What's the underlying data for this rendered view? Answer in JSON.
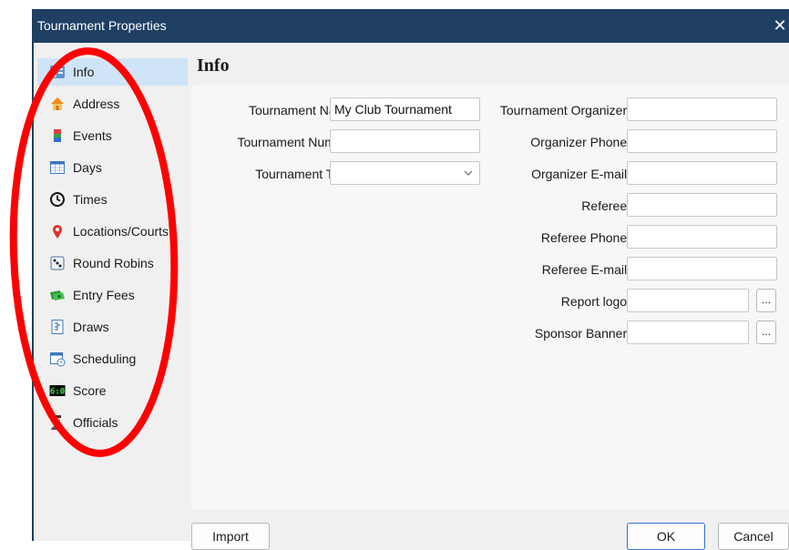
{
  "window": {
    "title": "Tournament Properties",
    "close_glyph": "✕"
  },
  "sidebar": {
    "items": [
      {
        "label": "Info",
        "icon": "info-icon"
      },
      {
        "label": "Address",
        "icon": "house-icon"
      },
      {
        "label": "Events",
        "icon": "events-icon"
      },
      {
        "label": "Days",
        "icon": "calendar-icon"
      },
      {
        "label": "Times",
        "icon": "clock-icon"
      },
      {
        "label": "Locations/Courts",
        "icon": "location-pin-icon"
      },
      {
        "label": "Round Robins",
        "icon": "round-robin-icon"
      },
      {
        "label": "Entry Fees",
        "icon": "money-icon"
      },
      {
        "label": "Draws",
        "icon": "draws-icon"
      },
      {
        "label": "Scheduling",
        "icon": "scheduling-icon"
      },
      {
        "label": "Score",
        "icon": "score-icon"
      },
      {
        "label": "Officials",
        "icon": "officials-icon"
      }
    ],
    "selected": "Info"
  },
  "main": {
    "title": "Info",
    "left_fields": {
      "tournament_name": {
        "label": "Tournament Name:",
        "value": "My Club Tournament"
      },
      "tournament_number": {
        "label": "Tournament Number:",
        "value": ""
      },
      "tournament_type": {
        "label": "Tournament Type:",
        "value": ""
      }
    },
    "right_fields": {
      "organizer": {
        "label": "Tournament Organizer:",
        "value": ""
      },
      "organizer_phone": {
        "label": "Organizer Phone:",
        "value": ""
      },
      "organizer_email": {
        "label": "Organizer E-mail:",
        "value": ""
      },
      "referee": {
        "label": "Referee:",
        "value": ""
      },
      "referee_phone": {
        "label": "Referee Phone:",
        "value": ""
      },
      "referee_email": {
        "label": "Referee E-mail:",
        "value": ""
      },
      "report_logo": {
        "label": "Report logo:",
        "value": ""
      },
      "sponsor_banner": {
        "label": "Sponsor Banner:",
        "value": ""
      }
    },
    "browse_label": "..."
  },
  "footer": {
    "import_label": "Import",
    "ok_label": "OK",
    "cancel_label": "Cancel"
  },
  "colors": {
    "titlebar": "#1f3f63",
    "selected": "#cfe4f7",
    "annotation": "#ff0000",
    "primary_border": "#2f6fd0"
  }
}
